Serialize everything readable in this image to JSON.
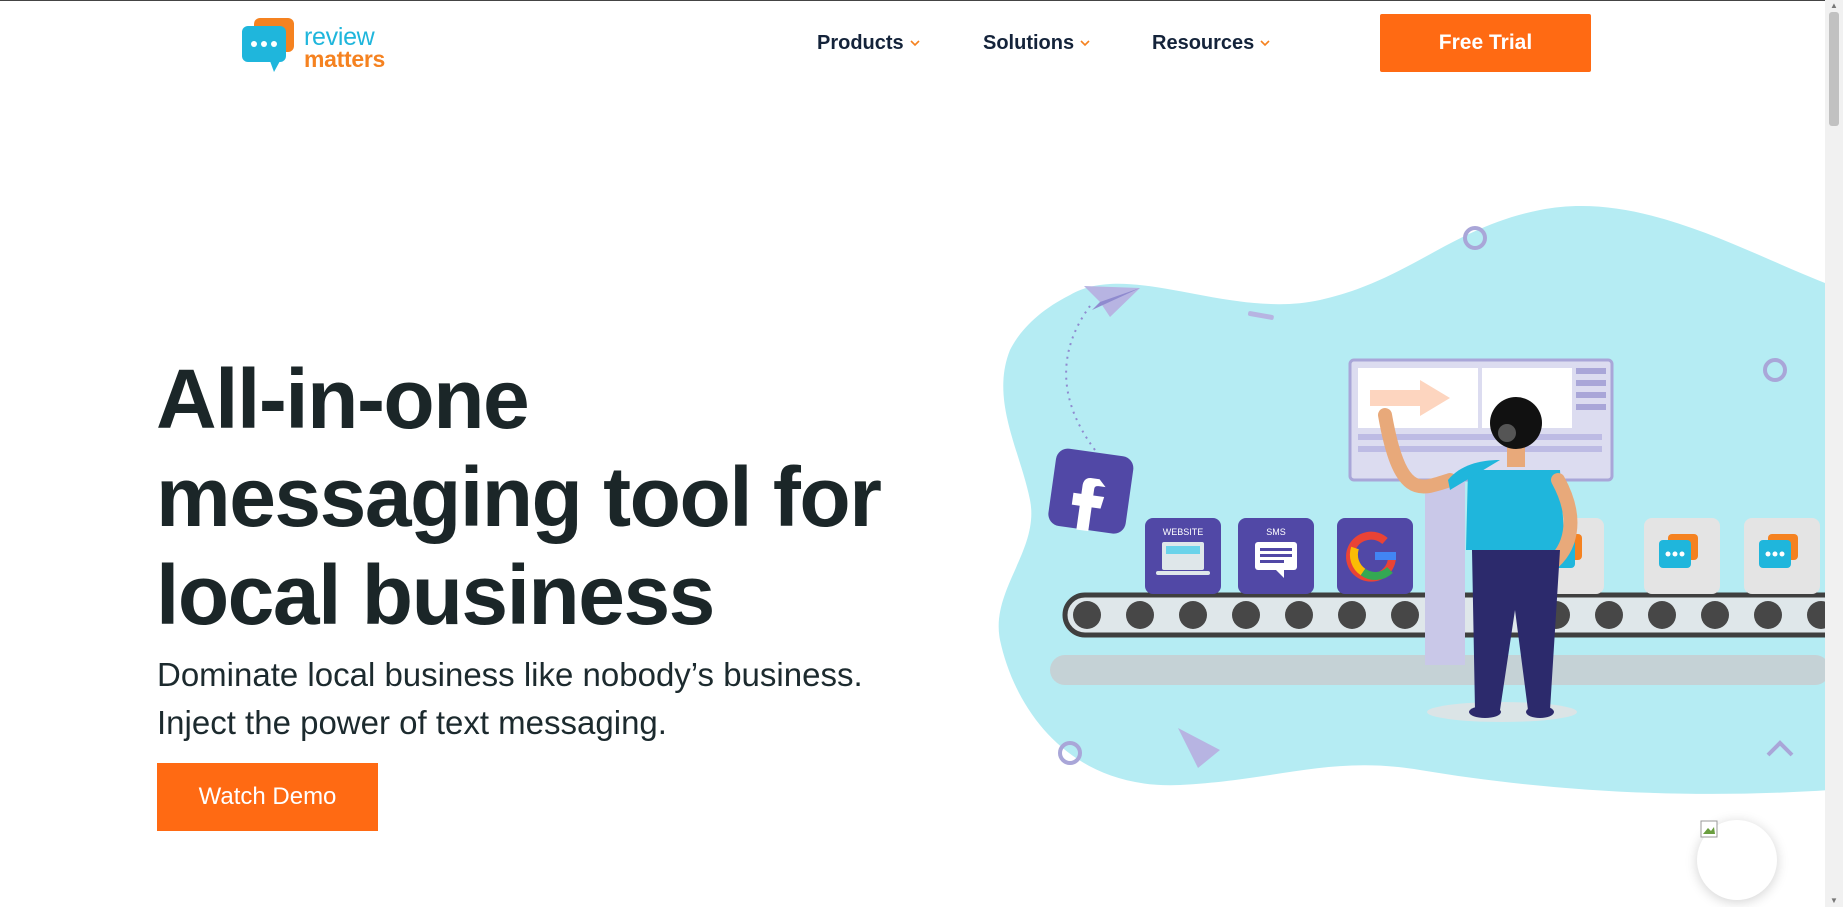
{
  "header": {
    "logo": {
      "line1": "review",
      "line2": "matters"
    },
    "nav": [
      {
        "label": "Products"
      },
      {
        "label": "Solutions"
      },
      {
        "label": "Resources"
      }
    ],
    "cta_label": "Free Trial"
  },
  "hero": {
    "headline_lines": [
      "All-in-one",
      "messaging tool for",
      "local business"
    ],
    "subhead_lines": [
      "Dominate local business like nobody’s business.",
      "Inject the power of text messaging."
    ],
    "button_label": "Watch Demo",
    "illustration": {
      "box_labels": {
        "website": "WEBSITE",
        "sms": "SMS"
      }
    }
  },
  "colors": {
    "accent": "#ff6a13",
    "brand_blue": "#1fb6dc",
    "brand_orange": "#f58220",
    "heading": "#1b2628",
    "nav_text": "#14233a",
    "blob": "#b5ecf3",
    "purple": "#5148a6"
  },
  "icons": [
    "chat-bubble-logo-icon",
    "chevron-down-icon",
    "facebook-icon",
    "google-icon",
    "website-icon",
    "sms-icon",
    "paper-plane-icon",
    "chat-widget-icon"
  ]
}
